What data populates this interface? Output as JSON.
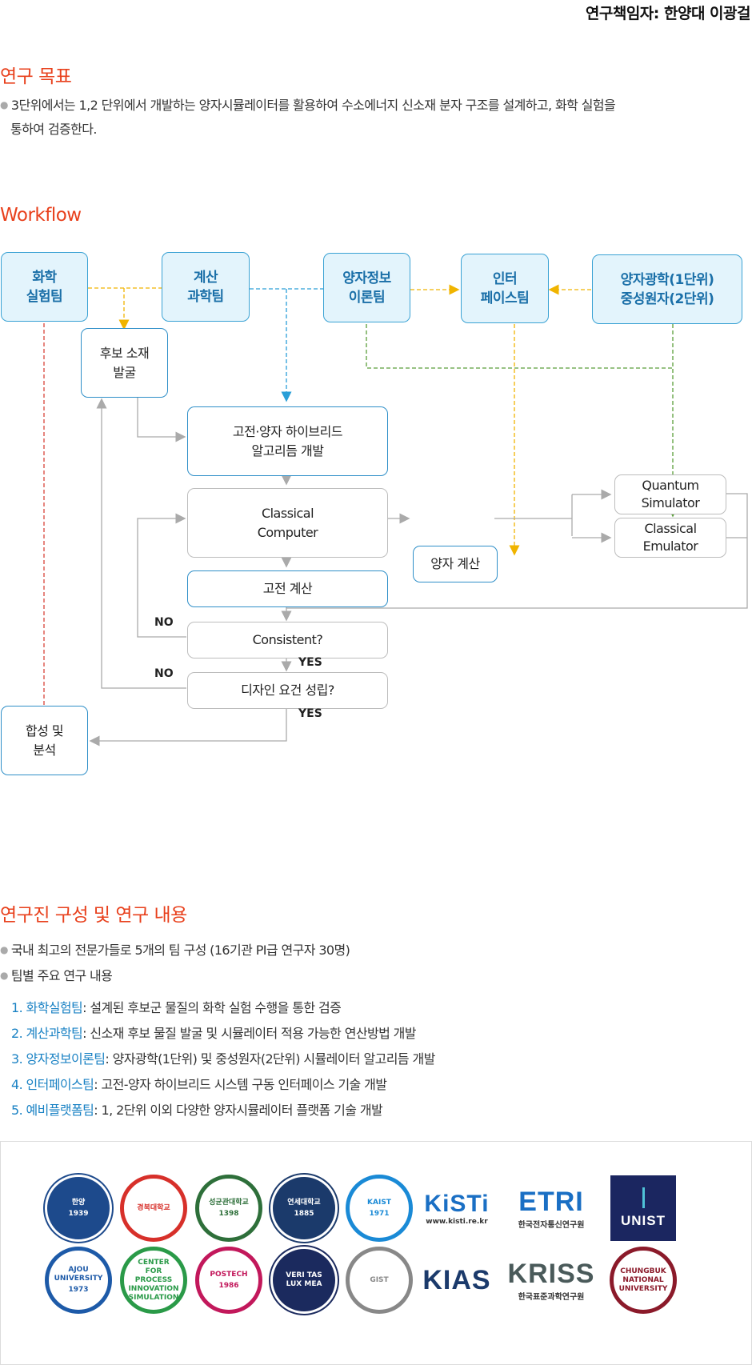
{
  "header": {
    "principal_investigator": "연구책임자: 한양대 이광걸"
  },
  "goal": {
    "title": "연구 목표",
    "text_line1": "3단위에서는 1,2 단위에서 개발하는 양자시뮬레이터를 활용하여 수소에너지 신소재 분자 구조를 설계하고, 화학 실험을",
    "text_line2": "통하여 검증한다."
  },
  "workflow": {
    "title": "Workflow",
    "teams": {
      "chem": [
        "화학",
        "실험팀"
      ],
      "comp": [
        "계산",
        "과학팀"
      ],
      "qinfo": [
        "양자정보",
        "이론팀"
      ],
      "iface": [
        "인터",
        "페이스팀"
      ],
      "qopt": [
        "양자광학(1단위)",
        "중성원자(2단위)"
      ]
    },
    "nodes": {
      "candidate": [
        "후보 소재",
        "발굴"
      ],
      "hybrid": [
        "고전·양자 하이브리드",
        "알고리듬 개발"
      ],
      "classical_computer": [
        "Classical",
        "Computer"
      ],
      "quantum_calc": "양자 계산",
      "quantum_sim": [
        "Quantum",
        "Simulator"
      ],
      "classical_emu": [
        "Classical",
        "Emulator"
      ],
      "classical_calc": "고전 계산",
      "consistent": "Consistent?",
      "design": "디자인 요건 성립?",
      "synthesis": [
        "합성 및",
        "분석"
      ]
    },
    "labels": {
      "no1": "NO",
      "yes1": "YES",
      "no2": "NO",
      "yes2": "YES"
    },
    "colors": {
      "yellow": "#f0b400",
      "blue": "#2a9fd8",
      "green": "#5a9e3a",
      "red": "#d9443a",
      "gray": "#aaaaaa"
    }
  },
  "research": {
    "title": "연구진 구성 및 연구 내용",
    "bullet1": "국내 최고의 전문가들로 5개의 팀 구성 (16기관 PI급 연구자 30명)",
    "bullet2": "팀별 주요 연구 내용",
    "teams": [
      {
        "name": "1. 화학실험팀",
        "desc": ": 설계된 후보군 물질의 화학 실험 수행을 통한 검증"
      },
      {
        "name": "2. 계산과학팀",
        "desc": ": 신소재 후보 물질 발굴 및 시뮬레이터 적용 가능한 연산방법 개발"
      },
      {
        "name": "3. 양자정보이론팀",
        "desc": ": 양자광학(1단위) 및 중성원자(2단위) 시뮬레이터 알고리듬 개발"
      },
      {
        "name": "4. 인터페이스팀",
        "desc": ": 고전-양자 하이브리드 시스템 구동 인터페이스 기술 개발"
      },
      {
        "name": "5. 예비플랫폼팀",
        "desc": ": 1, 2단위 이외 다양한 양자시뮬레이터 플랫폼 기술 개발"
      }
    ]
  },
  "logos": {
    "row1": [
      {
        "id": "hanyang",
        "text": "한양",
        "sub": "1939",
        "color": "#1d4a8c"
      },
      {
        "id": "kyungpook",
        "text": "경북대학교",
        "sub": "",
        "color": "#d7302a"
      },
      {
        "id": "skku",
        "text": "성균관대학교",
        "sub": "1398",
        "color": "#2e6f3a"
      },
      {
        "id": "yonsei",
        "text": "연세대학교",
        "sub": "1885",
        "color": "#1b3a6b"
      },
      {
        "id": "kaist",
        "text": "KAIST",
        "sub": "1971",
        "color": "#1a8ad6"
      },
      {
        "id": "kisti",
        "text": "KiSTi",
        "sub": "www.kisti.re.kr",
        "color": "#1a6fc4"
      },
      {
        "id": "etri",
        "text": "ETRI",
        "sub": "한국전자통신연구원",
        "color": "#1a6fc4"
      },
      {
        "id": "unist",
        "text": "UNIST",
        "sub": "",
        "color": "#1b2660"
      }
    ],
    "row2": [
      {
        "id": "ajou",
        "text": "AJOU UNIVERSITY",
        "sub": "1973",
        "color": "#1d5aa8"
      },
      {
        "id": "cpis",
        "text": "CENTER FOR PROCESS INNOVATION SIMULATION",
        "sub": "",
        "color": "#2a9a48"
      },
      {
        "id": "postech",
        "text": "POSTECH",
        "sub": "1986",
        "color": "#c2185b"
      },
      {
        "id": "snu",
        "text": "VERI TAS LUX MEA",
        "sub": "",
        "color": "#1b2a5e"
      },
      {
        "id": "gist",
        "text": "GIST",
        "sub": "",
        "color": "#888888"
      },
      {
        "id": "kias",
        "text": "KIAS",
        "sub": "",
        "color": "#1b3a6b"
      },
      {
        "id": "kriss",
        "text": "KRISS",
        "sub": "한국표준과학연구원",
        "color": "#4a5a5a"
      },
      {
        "id": "chungbuk",
        "text": "CHUNGBUK NATIONAL UNIVERSITY",
        "sub": "",
        "color": "#8b1a2a"
      }
    ]
  }
}
